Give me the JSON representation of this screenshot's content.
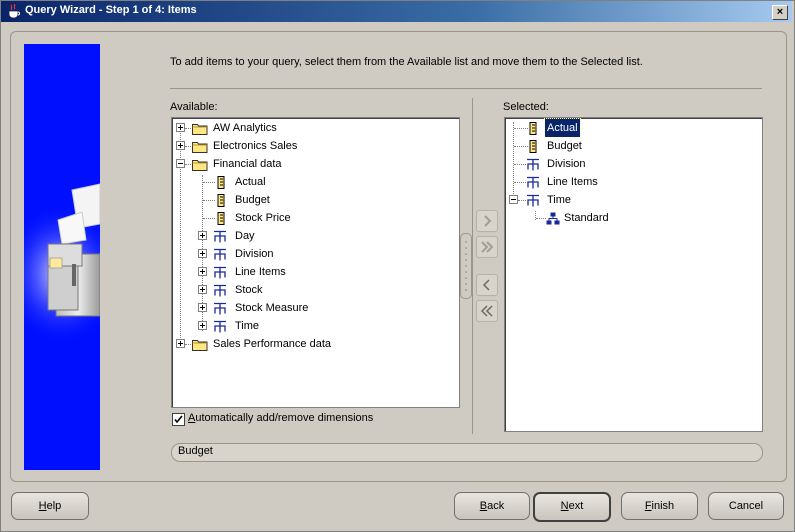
{
  "window": {
    "title": "Query Wizard - Step 1 of 4: Items",
    "close_label": "×"
  },
  "intro_text": "To add items to your query, select them from the Available list and move them to the Selected list.",
  "available": {
    "label": "Available:",
    "rows": [
      {
        "label": "AW Analytics",
        "icon": "folder-icon",
        "toggle": "plus"
      },
      {
        "label": "Electronics Sales",
        "icon": "folder-icon",
        "toggle": "plus"
      },
      {
        "label": "Financial data",
        "icon": "folder-icon",
        "toggle": "minus"
      },
      {
        "label": "Actual",
        "icon": "measure-icon"
      },
      {
        "label": "Budget",
        "icon": "measure-icon"
      },
      {
        "label": "Stock Price",
        "icon": "measure-icon"
      },
      {
        "label": "Day",
        "icon": "dimension-icon",
        "toggle": "plus"
      },
      {
        "label": "Division",
        "icon": "dimension-icon",
        "toggle": "plus"
      },
      {
        "label": "Line Items",
        "icon": "dimension-icon",
        "toggle": "plus"
      },
      {
        "label": "Stock",
        "icon": "dimension-icon",
        "toggle": "plus"
      },
      {
        "label": "Stock Measure",
        "icon": "dimension-icon",
        "toggle": "plus"
      },
      {
        "label": "Time",
        "icon": "dimension-icon",
        "toggle": "plus"
      },
      {
        "label": "Sales Performance data",
        "icon": "folder-icon",
        "toggle": "plus"
      }
    ]
  },
  "selected": {
    "label": "Selected:",
    "rows": [
      {
        "label": "Actual",
        "icon": "measure-icon",
        "selected": true
      },
      {
        "label": "Budget",
        "icon": "measure-icon"
      },
      {
        "label": "Division",
        "icon": "dimension-icon"
      },
      {
        "label": "Line Items",
        "icon": "dimension-icon"
      },
      {
        "label": "Time",
        "icon": "dimension-icon",
        "toggle": "minus"
      },
      {
        "label": "Standard",
        "icon": "hierarchy-icon"
      }
    ]
  },
  "move_buttons": [
    "move-right-icon",
    "move-all-right-icon",
    "move-left-icon",
    "move-all-left-icon"
  ],
  "auto_dimensions": {
    "label": "Automatically add/remove dimensions",
    "mnemonic": "A",
    "checked": true
  },
  "status_text": "Budget",
  "buttons": {
    "help": {
      "label": "Help",
      "mnemonic": "H"
    },
    "back": {
      "label": "Back",
      "mnemonic": "B"
    },
    "next": {
      "label": "Next",
      "mnemonic": "N"
    },
    "finish": {
      "label": "Finish",
      "mnemonic": "F"
    },
    "cancel": {
      "label": "Cancel"
    }
  },
  "colors": {
    "banner": "#0010ff",
    "selection": "#0a246a",
    "titlebar": "#0a246a"
  }
}
